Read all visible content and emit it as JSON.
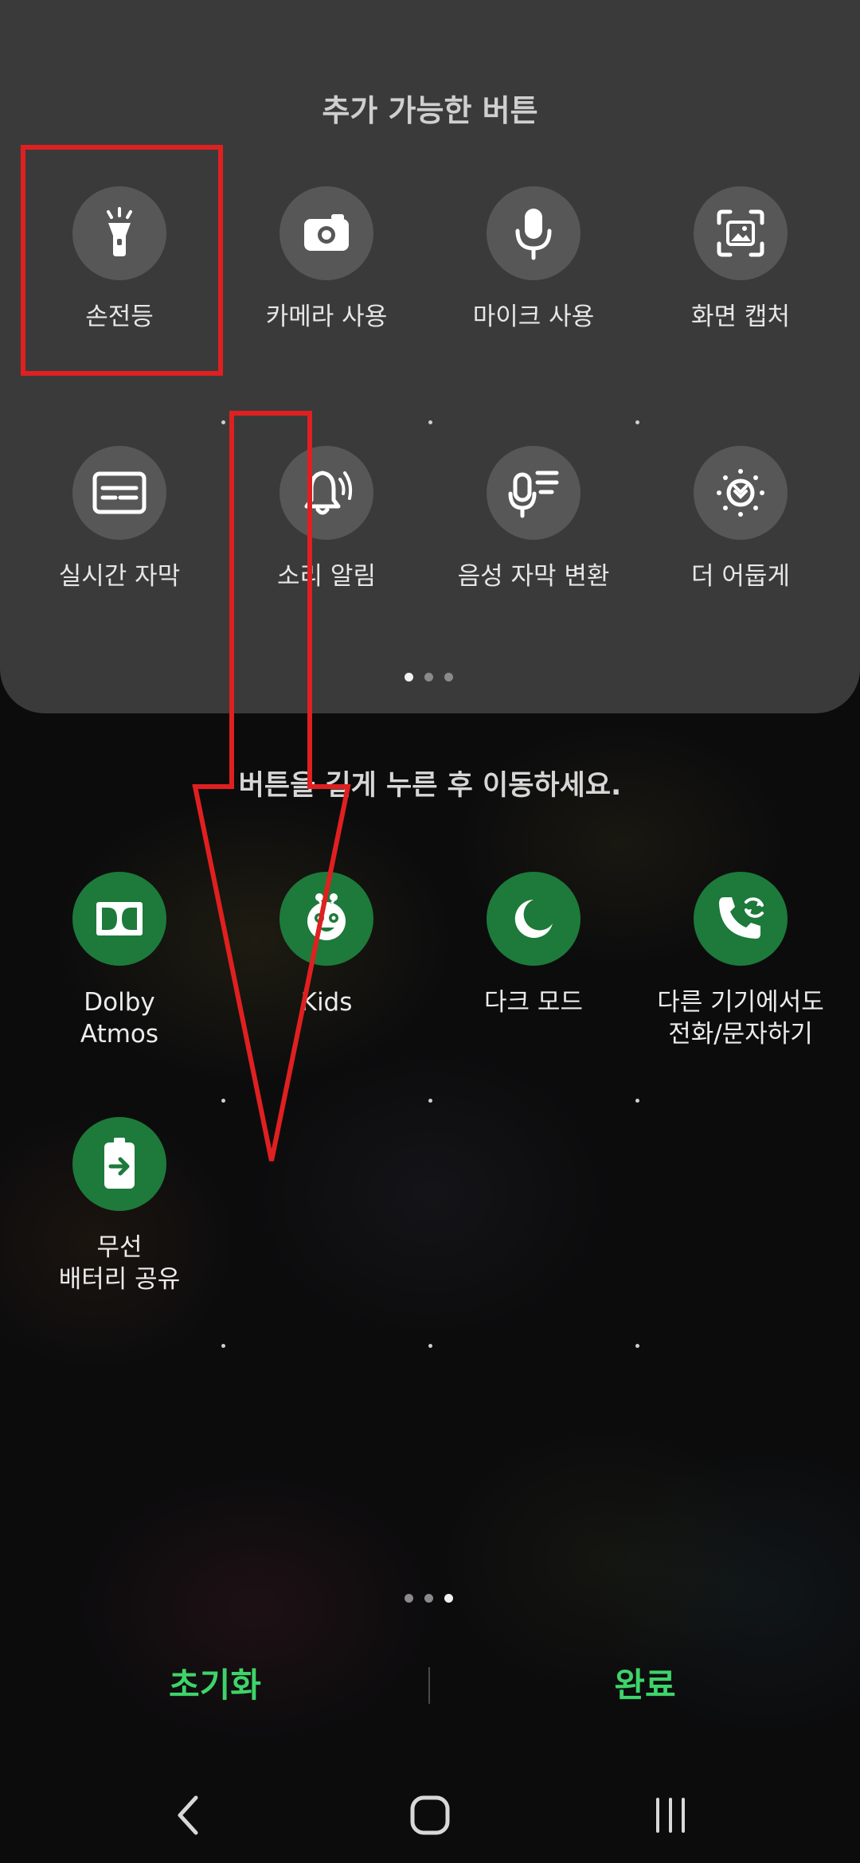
{
  "panel": {
    "title": "추가 가능한 버튼",
    "tiles": [
      {
        "label": "손전등",
        "icon": "flashlight-icon"
      },
      {
        "label": "카메라 사용",
        "icon": "camera-icon"
      },
      {
        "label": "마이크 사용",
        "icon": "microphone-icon"
      },
      {
        "label": "화면 캡처",
        "icon": "screenshot-icon"
      },
      {
        "label": "실시간 자막",
        "icon": "live-caption-icon"
      },
      {
        "label": "소리 알림",
        "icon": "sound-notification-icon"
      },
      {
        "label": "음성 자막 변환",
        "icon": "voice-caption-icon"
      },
      {
        "label": "더 어둡게",
        "icon": "extra-dim-icon"
      }
    ],
    "page_indicator": {
      "pages": 3,
      "current": 1
    }
  },
  "hint": "버튼을 길게 누른 후 이동하세요.",
  "active": {
    "tiles": [
      {
        "label": "Dolby\nAtmos",
        "icon": "dolby-atmos-icon"
      },
      {
        "label": "Kids",
        "icon": "kids-icon"
      },
      {
        "label": "다크 모드",
        "icon": "moon-icon"
      },
      {
        "label": "다른 기기에서도\n전화/문자하기",
        "icon": "call-sync-icon"
      },
      {
        "label": "무선\n배터리 공유",
        "icon": "battery-share-icon"
      }
    ],
    "page_indicator": {
      "pages": 3,
      "current": 3
    }
  },
  "actions": {
    "reset_label": "초기화",
    "done_label": "완료"
  },
  "nav": {
    "back": "back-icon",
    "home": "home-icon",
    "recents": "recents-icon"
  },
  "colors": {
    "panel_bg": "#3a3a3b",
    "tile_gray": "#575758",
    "tile_green": "#1d7a3a",
    "accent_green": "#3ed46a",
    "annotation_red": "#e02020"
  }
}
